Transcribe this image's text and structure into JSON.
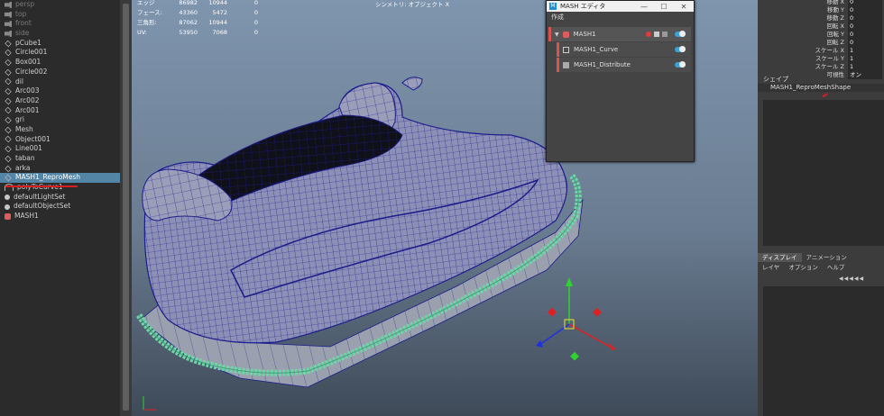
{
  "outliner": {
    "items": [
      {
        "label": "persp",
        "icon": "camera-icon",
        "dim": true
      },
      {
        "label": "top",
        "icon": "camera-icon",
        "dim": true
      },
      {
        "label": "front",
        "icon": "camera-icon",
        "dim": true
      },
      {
        "label": "side",
        "icon": "camera-icon",
        "dim": true
      },
      {
        "label": "pCube1",
        "icon": "mesh-icon"
      },
      {
        "label": "Circle001",
        "icon": "mesh-icon"
      },
      {
        "label": "Box001",
        "icon": "mesh-icon"
      },
      {
        "label": "Circle002",
        "icon": "mesh-icon"
      },
      {
        "label": "dil",
        "icon": "mesh-icon"
      },
      {
        "label": "Arc003",
        "icon": "mesh-icon"
      },
      {
        "label": "Arc002",
        "icon": "mesh-icon"
      },
      {
        "label": "Arc001",
        "icon": "mesh-icon"
      },
      {
        "label": "gri",
        "icon": "mesh-icon"
      },
      {
        "label": "Mesh",
        "icon": "mesh-icon"
      },
      {
        "label": "Object001",
        "icon": "mesh-icon"
      },
      {
        "label": "Line001",
        "icon": "mesh-icon"
      },
      {
        "label": "taban",
        "icon": "mesh-icon"
      },
      {
        "label": "arka",
        "icon": "mesh-icon"
      },
      {
        "label": "MASH1_ReproMesh",
        "icon": "mesh-icon",
        "selected": true
      },
      {
        "label": "polyToCurve1",
        "icon": "curve-icon"
      },
      {
        "label": "defaultLightSet",
        "icon": "set-icon"
      },
      {
        "label": "defaultObjectSet",
        "icon": "set-icon"
      },
      {
        "label": "MASH1",
        "icon": "mash-icon"
      }
    ]
  },
  "viewport": {
    "title": "シンメトリ: オブジェクト X",
    "hud": [
      {
        "label": "エッジ",
        "a": "86982",
        "b": "10944",
        "c": "0"
      },
      {
        "label": "フェース:",
        "a": "43360",
        "b": "5472",
        "c": "0"
      },
      {
        "label": "三角形:",
        "a": "87062",
        "b": "10944",
        "c": "0"
      },
      {
        "label": "UV:",
        "a": "53950",
        "b": "7068",
        "c": "0"
      }
    ]
  },
  "mash_editor": {
    "title": "MASH エディタ",
    "menu": "作成",
    "rows": [
      {
        "label": "MASH1"
      },
      {
        "label": "MASH1_Curve"
      },
      {
        "label": "MASH1_Distribute"
      }
    ],
    "accent": "#d9534f",
    "toggle_color": "#3ea0d8"
  },
  "attributes": {
    "rows": [
      {
        "label": "移動 X",
        "value": "0"
      },
      {
        "label": "移動 Y",
        "value": "0"
      },
      {
        "label": "移動 Z",
        "value": "0"
      },
      {
        "label": "回転 X",
        "value": "0"
      },
      {
        "label": "回転 Y",
        "value": "0"
      },
      {
        "label": "回転 Z",
        "value": "0"
      },
      {
        "label": "スケール X",
        "value": "1"
      },
      {
        "label": "スケール Y",
        "value": "1"
      },
      {
        "label": "スケール Z",
        "value": "1"
      },
      {
        "label": "可視性",
        "value": "オン"
      }
    ],
    "shape_header": "シェイプ",
    "shape_name": "MASH1_ReproMeshShape"
  },
  "layers": {
    "tabs": [
      "ディスプレイ",
      "アニメーション"
    ],
    "menu": [
      "レイヤ",
      "オプション",
      "ヘルプ"
    ]
  },
  "colors": {
    "selection": "#5285a6",
    "wire": "#1c1c8c",
    "teal": "#6fd6a8"
  }
}
